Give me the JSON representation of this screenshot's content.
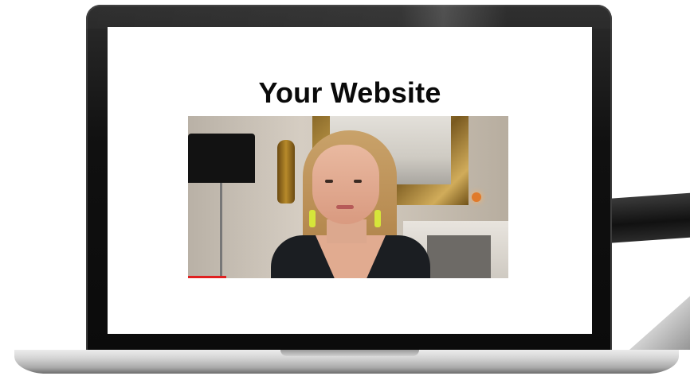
{
  "website": {
    "title": "Your Website"
  },
  "video": {
    "icon": "video-thumbnail"
  },
  "colors": {
    "laptop_bezel": "#0b0b0b",
    "screen_background": "#ffffff",
    "title_text": "#0a0a0a",
    "laptop_base": "#d4d4d4"
  }
}
